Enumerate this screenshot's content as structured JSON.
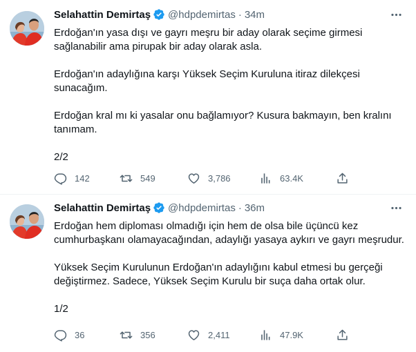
{
  "theme": {
    "text": "#0f1419",
    "muted": "#536471",
    "verified": "#1d9bf0",
    "divider": "#eff3f4"
  },
  "tweets": [
    {
      "name": "Selahattin Demirtaş",
      "handle": "@hdpdemirtas",
      "separator": "·",
      "time": "34m",
      "paragraphs": [
        "Erdoğan'ın yasa dışı ve gayrı meşru bir aday olarak seçime girmesi sağlanabilir ama pirupak bir aday olarak asla.",
        "Erdoğan'ın adaylığına karşı Yüksek Seçim Kuruluna itiraz dilekçesi sunacağım.",
        "Erdoğan kral mı ki yasalar onu bağlamıyor? Kusura bakmayın, ben kralını tanımam.",
        "2/2"
      ],
      "replies": "142",
      "retweets": "549",
      "likes": "3,786",
      "views": "63.4K"
    },
    {
      "name": "Selahattin Demirtaş",
      "handle": "@hdpdemirtas",
      "separator": "·",
      "time": "36m",
      "paragraphs": [
        "Erdoğan hem diploması olmadığı için hem de olsa bile üçüncü kez cumhurbaşkanı olamayacağından, adaylığı yasaya aykırı ve gayrı meşrudur.",
        "Yüksek Seçim Kurulunun Erdoğan'ın adaylığını kabul etmesi bu gerçeği değiştirmez. Sadece, Yüksek Seçim Kurulu bir suça daha ortak olur.",
        "1/2"
      ],
      "replies": "36",
      "retweets": "356",
      "likes": "2,411",
      "views": "47.9K"
    }
  ]
}
